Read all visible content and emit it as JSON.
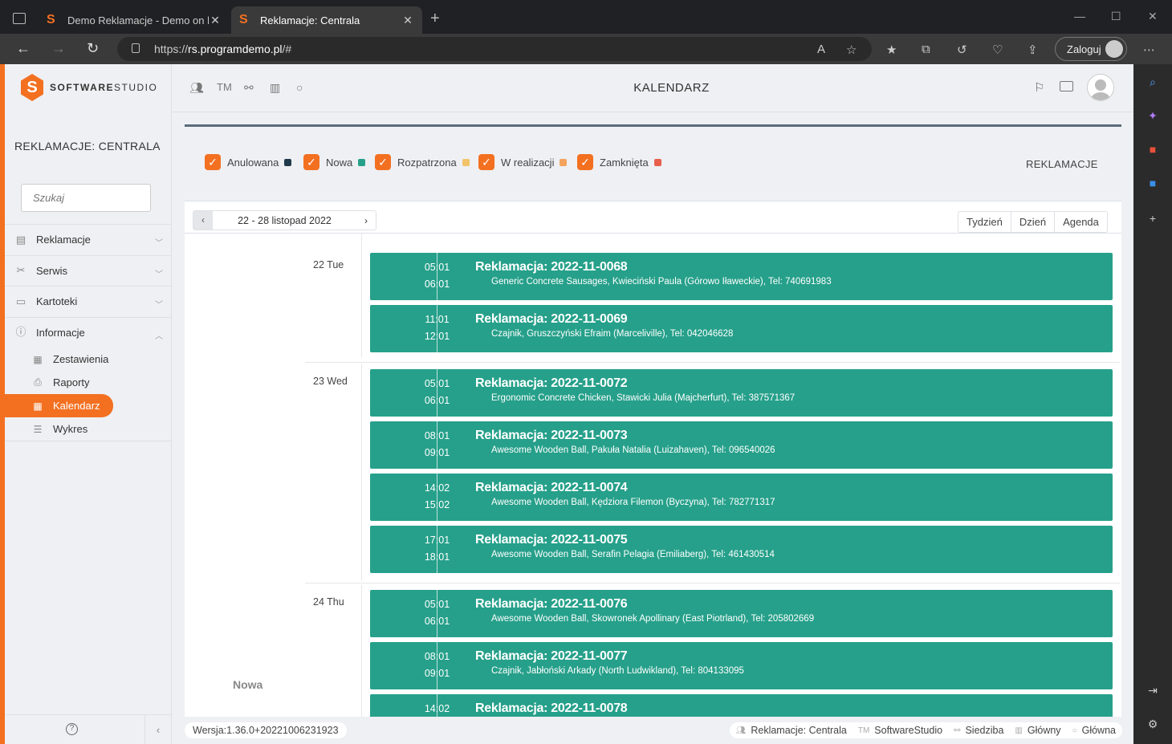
{
  "browser": {
    "tabs": [
      {
        "title": "Demo Reklamacje - Demo on lin",
        "active": false
      },
      {
        "title": "Reklamacje: Centrala",
        "active": true
      }
    ],
    "url_scheme": "https://",
    "url_host": "rs.programdemo.pl",
    "url_path": "/#",
    "login_label": "Zaloguj"
  },
  "brand": {
    "name_bold": "SOFTWARE",
    "name_light": "STUDIO",
    "mark": "S",
    "accent": "#f37021"
  },
  "sidebar": {
    "title": "REKLAMACJE: CENTRALA",
    "search_placeholder": "Szukaj",
    "items": [
      {
        "label": "Reklamacje",
        "icon": "document-icon"
      },
      {
        "label": "Serwis",
        "icon": "tools-icon"
      },
      {
        "label": "Kartoteki",
        "icon": "folder-icon"
      },
      {
        "label": "Informacje",
        "icon": "info-icon"
      }
    ],
    "subitems": [
      {
        "label": "Zestawienia",
        "icon": "table-icon"
      },
      {
        "label": "Raporty",
        "icon": "printer-icon"
      },
      {
        "label": "Kalendarz",
        "icon": "calendar-icon",
        "active": true
      },
      {
        "label": "Wykres",
        "icon": "chart-icon"
      }
    ]
  },
  "header": {
    "title": "KALENDARZ",
    "tm": "TM"
  },
  "filters": {
    "items": [
      {
        "label": "Anulowana",
        "color": "#1f3a4a"
      },
      {
        "label": "Nowa",
        "color": "#26a08a"
      },
      {
        "label": "Rozpatrzona",
        "color": "#f2c36b"
      },
      {
        "label": "W realizacji",
        "color": "#f5a35c"
      },
      {
        "label": "Zamknięta",
        "color": "#e8604c"
      }
    ],
    "module_label": "REKLAMACJE"
  },
  "calendar": {
    "range": "22 - 28 listopad 2022",
    "views": [
      "Tydzień",
      "Dzień",
      "Agenda"
    ],
    "legend_label": "Nowa",
    "days": [
      {
        "label": "22 Tue",
        "events": [
          {
            "start": "05:01",
            "end": "06:01",
            "title": "Reklamacja: 2022-11-0068",
            "desc": "Generic Concrete Sausages, Kwieciński Paula (Górowo Iławeckie), Tel: 740691983"
          },
          {
            "start": "11:01",
            "end": "12:01",
            "title": "Reklamacja: 2022-11-0069",
            "desc": "Czajnik, Gruszczyński Efraim (Marceliville), Tel: 042046628"
          }
        ]
      },
      {
        "label": "23 Wed",
        "events": [
          {
            "start": "05:01",
            "end": "06:01",
            "title": "Reklamacja: 2022-11-0072",
            "desc": "Ergonomic Concrete Chicken, Stawicki Julia (Majcherfurt), Tel: 387571367"
          },
          {
            "start": "08:01",
            "end": "09:01",
            "title": "Reklamacja: 2022-11-0073",
            "desc": "Awesome Wooden Ball, Pakuła Natalia (Luizahaven), Tel: 096540026"
          },
          {
            "start": "14:02",
            "end": "15:02",
            "title": "Reklamacja: 2022-11-0074",
            "desc": "Awesome Wooden Ball, Kędziora Filemon (Byczyna), Tel: 782771317"
          },
          {
            "start": "17:01",
            "end": "18:01",
            "title": "Reklamacja: 2022-11-0075",
            "desc": "Awesome Wooden Ball, Serafin Pelagia (Emiliaberg), Tel: 461430514"
          }
        ]
      },
      {
        "label": "24 Thu",
        "events": [
          {
            "start": "05:01",
            "end": "06:01",
            "title": "Reklamacja: 2022-11-0076",
            "desc": "Awesome Wooden Ball, Skowronek Apollinary (East Piotrland), Tel: 205802669"
          },
          {
            "start": "08:01",
            "end": "09:01",
            "title": "Reklamacja: 2022-11-0077",
            "desc": "Czajnik, Jabłoński Arkady (North Ludwikland), Tel: 804133095"
          },
          {
            "start": "14:02",
            "end": "",
            "title": "Reklamacja: 2022-11-0078",
            "desc": ""
          }
        ]
      }
    ]
  },
  "footer": {
    "version": "Wersja:1.36.0+20221006231923",
    "crumbs": [
      "Reklamacje: Centrala",
      "SoftwareStudio",
      "Siedziba",
      "Główny",
      "Główna"
    ]
  }
}
